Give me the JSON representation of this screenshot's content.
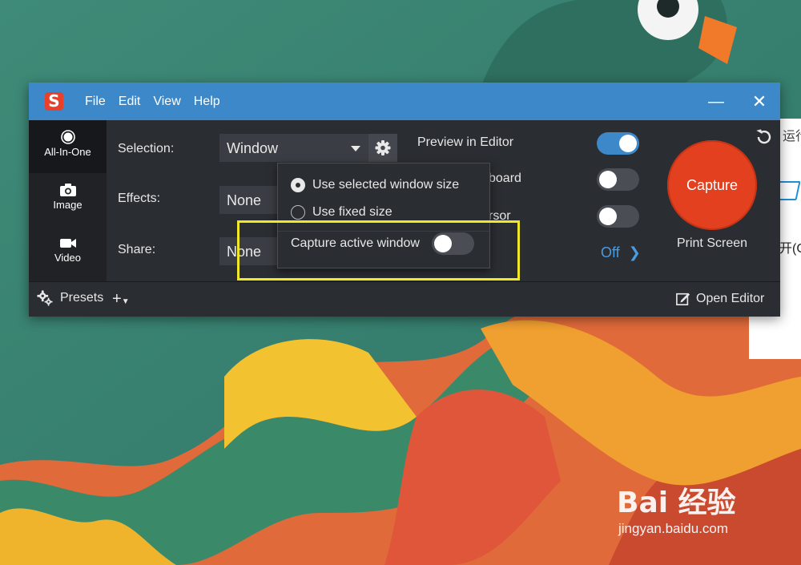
{
  "menu": [
    "File",
    "Edit",
    "View",
    "Help"
  ],
  "window_controls": {
    "minimize": "—",
    "close": "✕"
  },
  "sidebar": {
    "tabs": [
      {
        "label": "All-In-One",
        "icon": "all-in-one-icon",
        "active": true
      },
      {
        "label": "Image",
        "icon": "camera-icon",
        "active": false
      },
      {
        "label": "Video",
        "icon": "video-camera-icon",
        "active": false
      }
    ]
  },
  "options": {
    "selection_label": "Selection:",
    "selection_value": "Window",
    "effects_label": "Effects:",
    "effects_value": "None",
    "share_label": "Share:",
    "share_value": "None"
  },
  "toggles": [
    {
      "label": "Preview in Editor",
      "on": true
    },
    {
      "label": "board",
      "on": false
    },
    {
      "label": "rsor",
      "on": false
    }
  ],
  "record_audio": {
    "value": "Off"
  },
  "capture": {
    "button_label": "Capture",
    "shortcut": "Print Screen"
  },
  "popup": {
    "radio_options": [
      {
        "label": "Use selected window size",
        "checked": true
      },
      {
        "label": "Use fixed size",
        "checked": false
      }
    ],
    "toggle_label": "Capture active window",
    "toggle_on": false
  },
  "bottom": {
    "presets_label": "Presets",
    "add_label": "+",
    "open_editor_label": "Open Editor"
  },
  "background_app": {
    "text1": "运行",
    "text2": "开(C"
  },
  "watermark": {
    "main": "Bai 经验",
    "sub": "jingyan.baidu.com"
  },
  "colors": {
    "titlebar": "#3d88c8",
    "capture": "#e2401f",
    "highlight": "#f0e62a",
    "toggle_on": "#3d88c8"
  }
}
